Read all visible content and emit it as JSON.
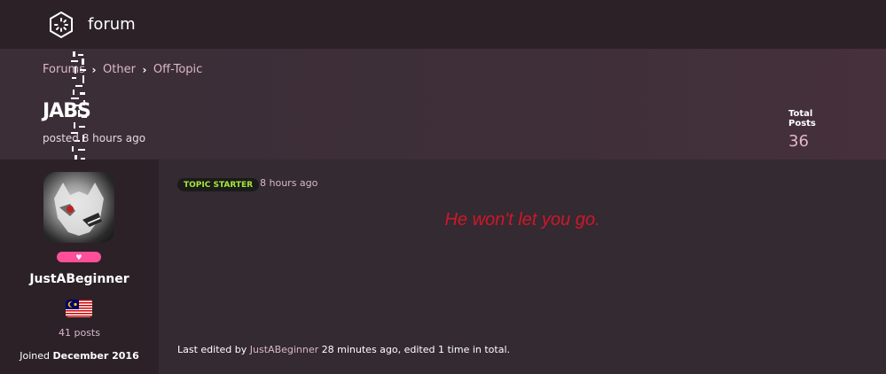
{
  "app": {
    "title": "forum",
    "logo_icon": "hexagon-loader-icon"
  },
  "breadcrumb": [
    {
      "label": "Forums"
    },
    {
      "label": "Other"
    },
    {
      "label": "Off-Topic"
    }
  ],
  "thread": {
    "title": "JABS",
    "posted": "posted 8 hours ago"
  },
  "stats": {
    "label": "Total Posts",
    "value": "36"
  },
  "author": {
    "name": "JustABeginner",
    "role_icon": "heart-icon",
    "flag": "malaysia-flag",
    "posts": "41 posts",
    "joined_prefix": "Joined",
    "joined_date": "December 2016"
  },
  "post": {
    "badge": "TOPIC STARTER",
    "time": "8 hours ago",
    "body": "He won't let you go.",
    "edited_prefix": "Last edited by",
    "edited_user": "JustABeginner",
    "edited_suffix": "28 minutes ago, edited 1 time in total."
  },
  "colors": {
    "accent": "#d9b8c9",
    "badge_text": "#a7e83a",
    "body_text": "#d0172a",
    "role_pill": "#ff4f9a"
  }
}
